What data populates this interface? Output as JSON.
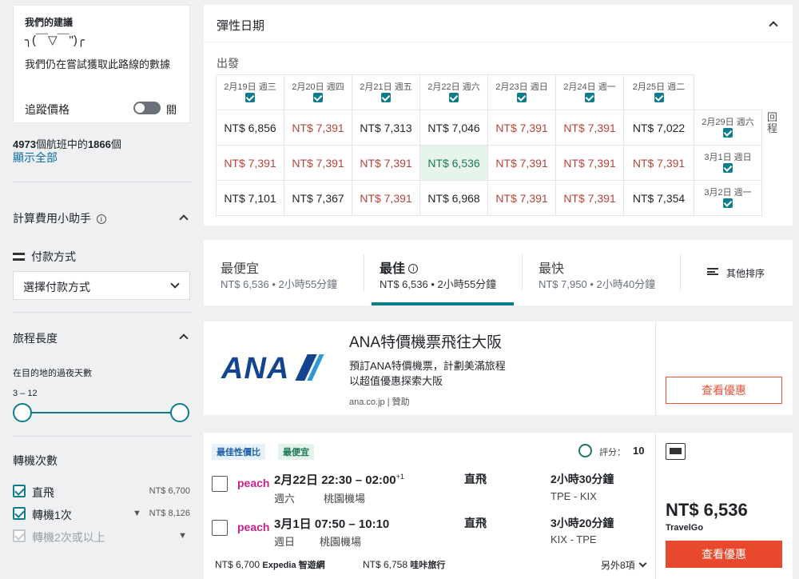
{
  "suggestion": {
    "title": "我們的建議",
    "face": "╮(￣▽￣\")╭",
    "message": "我們仍在嘗試獲取此路線的數據",
    "track_label": "追蹤價格",
    "toggle_state": "關"
  },
  "flights_count": {
    "total": "4973",
    "mid": "個航班中的",
    "shown": "1866",
    "suffix": "個",
    "show_all": "顯示全部"
  },
  "fee_helper": {
    "title": "計算費用小助手",
    "payment_label": "付款方式",
    "payment_select": "選擇付款方式"
  },
  "duration": {
    "title": "旅程長度",
    "nights_label": "在目的地的過夜天數",
    "range": "3 – 12"
  },
  "stops": {
    "title": "轉機次數",
    "items": [
      {
        "label": "直飛",
        "price": "NT$ 6,700",
        "checked": true
      },
      {
        "label": "轉機1次",
        "price": "NT$ 8,126",
        "checked": true
      },
      {
        "label": "轉機2次或以上",
        "price": "",
        "checked": false
      }
    ]
  },
  "flex": {
    "title": "彈性日期",
    "depart_label": "出發",
    "return_label": "回程",
    "dep_dates": [
      "2月19日 週三",
      "2月20日 週四",
      "2月21日 週五",
      "2月22日 週六",
      "2月23日 週日",
      "2月24日 週一",
      "2月25日 週二"
    ],
    "ret_dates": [
      "2月29日 週六",
      "3月1日 週日",
      "3月2日 週一"
    ],
    "rows": [
      [
        "NT$ 6,856",
        "NT$ 7,391",
        "NT$ 7,313",
        "NT$ 7,046",
        "NT$ 7,391",
        "NT$ 7,391",
        "NT$ 7,022"
      ],
      [
        "NT$ 7,391",
        "NT$ 7,391",
        "NT$ 7,391",
        "NT$ 6,536",
        "NT$ 7,391",
        "NT$ 7,391",
        "NT$ 7,391"
      ],
      [
        "NT$ 7,101",
        "NT$ 7,367",
        "NT$ 7,391",
        "NT$ 6,968",
        "NT$ 7,391",
        "NT$ 7,391",
        "NT$ 7,354"
      ]
    ]
  },
  "sort": {
    "tabs": [
      {
        "title": "最便宜",
        "sub": "NT$ 6,536 • 2小時55分鐘"
      },
      {
        "title": "最佳",
        "sub": "NT$ 6,536 • 2小時55分鐘"
      },
      {
        "title": "最快",
        "sub": "NT$ 7,950 • 2小時40分鐘"
      }
    ],
    "other": "其他排序"
  },
  "ad": {
    "logo": "ANA",
    "title": "ANA特價機票飛往大阪",
    "desc1": "預訂ANA特價機票，計劃美滿旅程",
    "desc2": "以超值優惠探索大阪",
    "source": "ana.co.jp | 贊助",
    "button": "查看優惠"
  },
  "result": {
    "badge_best_value": "最佳性價比",
    "badge_cheapest": "最便宜",
    "score_label": "評分：",
    "score": "10",
    "legs": [
      {
        "airline": "peach",
        "date": "2月22日",
        "time": "22:30 – 02:00",
        "plus": "+1",
        "weekday": "週六",
        "airport": "桃園機場",
        "stops": "直飛",
        "duration": "2小時30分鐘",
        "route": "TPE - KIX"
      },
      {
        "airline": "peach",
        "date": "3月1日",
        "time": "07:50 – 10:10",
        "plus": "",
        "weekday": "週日",
        "airport": "桃園機場",
        "stops": "直飛",
        "duration": "3小時20分鐘",
        "route": "KIX - TPE"
      }
    ],
    "price": "NT$ 6,536",
    "provider": "TravelGo",
    "button": "查看優惠",
    "alt1_price": "NT$ 6,700",
    "alt1_name": "Expedia 智遊網",
    "alt2_price": "NT$ 6,758",
    "alt2_name": "哇咔旅行",
    "more": "另外8項"
  }
}
